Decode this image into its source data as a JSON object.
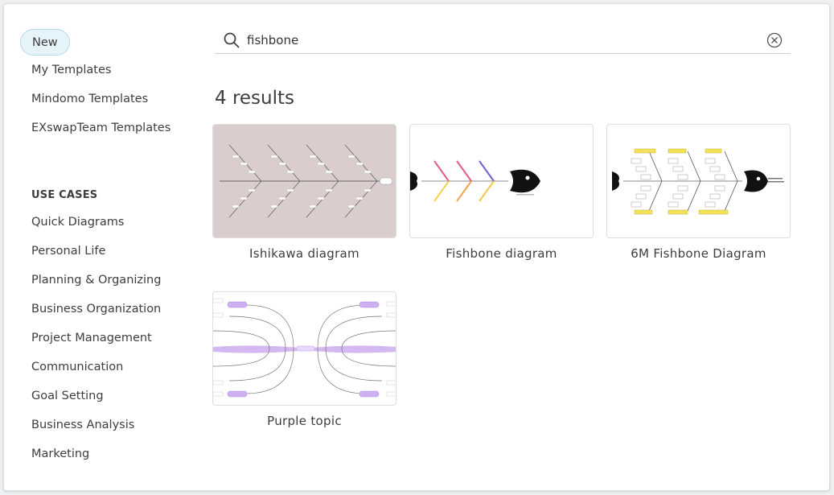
{
  "sidebar": {
    "primary": [
      {
        "label": "New",
        "active": true
      },
      {
        "label": "My Templates"
      },
      {
        "label": "Mindomo Templates"
      },
      {
        "label": "EXswapTeam Templates"
      }
    ],
    "section_title": "USE CASES",
    "use_cases": [
      {
        "label": "Quick Diagrams"
      },
      {
        "label": "Personal Life"
      },
      {
        "label": "Planning & Organizing"
      },
      {
        "label": "Business Organization"
      },
      {
        "label": "Project Management"
      },
      {
        "label": "Communication"
      },
      {
        "label": "Goal Setting"
      },
      {
        "label": "Business Analysis"
      },
      {
        "label": "Marketing"
      }
    ]
  },
  "search": {
    "value": "fishbone",
    "icon": "search-icon",
    "clear_icon": "clear-circle-x-icon"
  },
  "results": {
    "count_label": "4 results",
    "items": [
      {
        "title": "Ishikawa diagram",
        "thumb_bg": "#d9cdcd"
      },
      {
        "title": "Fishbone diagram",
        "thumb_bg": "#ffffff"
      },
      {
        "title": "6M Fishbone Diagram",
        "thumb_bg": "#ffffff"
      },
      {
        "title": "Purple topic",
        "thumb_bg": "#ffffff"
      }
    ]
  },
  "colors": {
    "active_bg": "#e6f3f8",
    "active_border": "#b7dbe8",
    "purple": "#c9a8ee",
    "yellow": "#f4e35a"
  }
}
